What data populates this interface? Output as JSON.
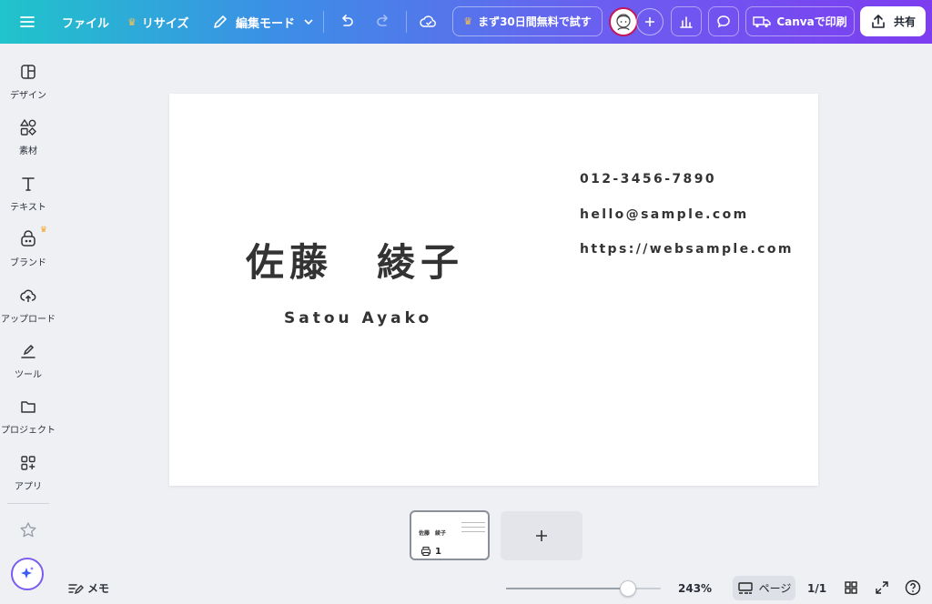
{
  "topbar": {
    "file_label": "ファイル",
    "resize_label": "リサイズ",
    "edit_mode_label": "編集モード",
    "trial_label": "まず30日間無料で試す",
    "print_label": "Canvaで印刷",
    "share_label": "共有"
  },
  "sidebar": {
    "items": [
      {
        "label": "デザイン"
      },
      {
        "label": "素材"
      },
      {
        "label": "テキスト"
      },
      {
        "label": "ブランド"
      },
      {
        "label": "アップロード"
      },
      {
        "label": "ツール"
      },
      {
        "label": "プロジェクト"
      },
      {
        "label": "アプリ"
      }
    ]
  },
  "card": {
    "name_jp": "佐藤　綾子",
    "name_roman": "Satou Ayako",
    "phone": "012-3456-7890",
    "email": "hello@sample.com",
    "website": "https://websample.com"
  },
  "thumbnail": {
    "name": "佐藤　綾子",
    "page_number": "1"
  },
  "bottombar": {
    "memo_label": "メモ",
    "zoom_value": 243,
    "zoom_label": "243%",
    "page_view_label": "ページ",
    "page_count": "1/1"
  },
  "colors": {
    "gradient_start": "#20c4cb",
    "gradient_end": "#7d3df0",
    "crown": "#ffc24d",
    "text_dark": "#333333"
  }
}
